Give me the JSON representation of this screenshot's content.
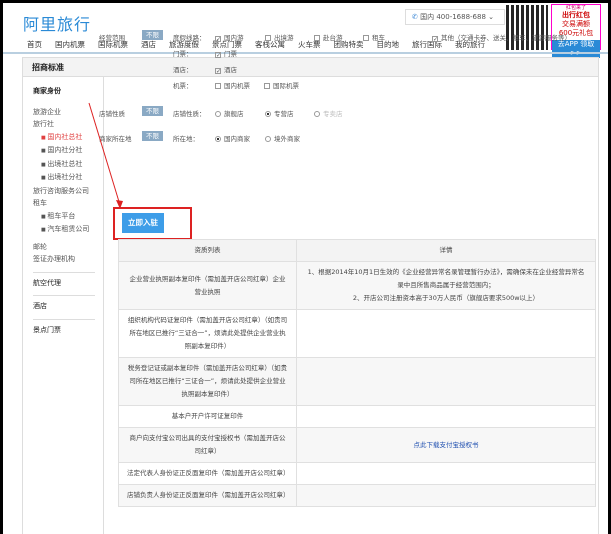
{
  "header": {
    "logo": "阿里旅行",
    "phone_label": "国内",
    "phone": "400-1688-688",
    "promo": [
      "红包来了",
      "出行红包",
      "交易满额",
      "600元礼包",
      "去APP 领取>>"
    ]
  },
  "nav": [
    "首页",
    "国内机票",
    "国际机票",
    "酒店",
    "旅游度假",
    "景点门票",
    "客栈公寓",
    "火车票",
    "团购特卖",
    "目的地",
    "旅行国际",
    "我的旅行"
  ],
  "panel_title": "招商标准",
  "sidebar": {
    "heading": "商家身份",
    "items": [
      {
        "label": "旅游企业",
        "type": "group"
      },
      {
        "label": "旅行社",
        "type": "group"
      },
      {
        "label": "国内社总社",
        "type": "sub",
        "active": true
      },
      {
        "label": "国内社分社",
        "type": "sub"
      },
      {
        "label": "出境社总社",
        "type": "sub"
      },
      {
        "label": "出境社分社",
        "type": "sub"
      },
      {
        "label": "旅行咨询服务公司",
        "type": "group"
      },
      {
        "label": "租车",
        "type": "group"
      },
      {
        "label": "租车平台",
        "type": "sub"
      },
      {
        "label": "汽车租赁公司",
        "type": "sub"
      },
      {
        "label": "邮轮",
        "type": "group"
      },
      {
        "label": "签证办理机构",
        "type": "group"
      }
    ],
    "sections": [
      "航空代理",
      "酒店",
      "景点门票"
    ]
  },
  "filters": {
    "scope_label": "经营范围",
    "unlimited": "不限",
    "vacation_label": "度假线路：",
    "vacation": [
      {
        "label": "国内游",
        "checked": true
      },
      {
        "label": "出境游",
        "checked": false
      },
      {
        "label": "赴台游",
        "checked": false
      },
      {
        "label": "租车",
        "checked": false
      },
      {
        "label": "其他（交通卡券、送关、租车、旅游服务等）",
        "checked": true
      }
    ],
    "ticket_label": "门票：",
    "ticket": "门票",
    "hotel_label": "酒店：",
    "hotel": "酒店",
    "flight_label": "机票：",
    "flight": [
      "国内机票",
      "国际机票"
    ],
    "store_label": "店铺性质",
    "store_sub": "店铺性质：",
    "store": [
      {
        "label": "旗舰店",
        "on": false
      },
      {
        "label": "专营店",
        "on": true
      },
      {
        "label": "专卖店",
        "on": false,
        "disabled": true
      }
    ],
    "loc_label": "商家所在地",
    "loc_sub": "所在地：",
    "loc": [
      {
        "label": "国内商家",
        "on": true
      },
      {
        "label": "境外商家",
        "on": false
      }
    ]
  },
  "join_button": "立即入驻",
  "table": {
    "headers": [
      "资质列表",
      "详情"
    ],
    "rows": [
      [
        "企业营业执照副本复印件（需加盖开店公司红章）企业营业执照",
        "1、根据2014年10月1日生效的《企业经营异常名录管理暂行办法》，需确保未在企业经营异常名录中且所售商品属于经营范围内；\n2、开店公司注册资本高于30万人民币（旗舰店要求500w以上）"
      ],
      [
        "组织机构代码证复印件（需加盖开店公司红章）（如贵司所在地区已推行“三证合一”，烦请此处提供企业营业执照副本复印件）",
        ""
      ],
      [
        "税务登记证或副本复印件（需加盖开店公司红章）（如贵司所在地区已推行“三证合一”，烦请此处提供企业营业执照副本复印件）",
        ""
      ],
      [
        "基本户开户许可证复印件",
        ""
      ],
      [
        "商户向支付宝公司出具的支付宝授权书（需加盖开店公司红章）",
        "点此下载支付宝授权书"
      ],
      [
        "法定代表人身份证正反面复印件（需加盖开店公司红章）",
        ""
      ],
      [
        "店铺负责人身份证正反面复印件（需加盖开店公司红章）",
        ""
      ]
    ]
  }
}
